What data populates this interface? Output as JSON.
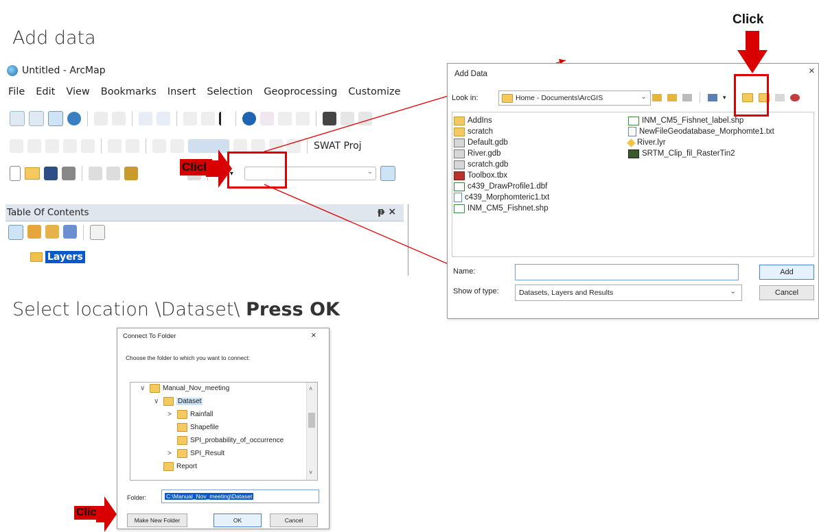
{
  "slide": {
    "title_add": "Add data",
    "title_select_prefix": "Select location \\Dataset\\ ",
    "title_select_bold": "Press OK",
    "click_label": "Click"
  },
  "arcmap": {
    "window_title": "Untitled - ArcMap",
    "menu": [
      "File",
      "Edit",
      "View",
      "Bookmarks",
      "Insert",
      "Selection",
      "Geoprocessing",
      "Customize"
    ],
    "swat_label": "SWAT Proj",
    "toc_title": "Table Of Contents",
    "toc_pin": "ј ×",
    "layers_label": "Layers"
  },
  "add_data": {
    "title": "Add Data",
    "close": "×",
    "look_in_label": "Look in:",
    "look_in_value": "Home - Documents\\ArcGIS",
    "files_left": [
      {
        "name": "AddIns",
        "icon": "folder"
      },
      {
        "name": "scratch",
        "icon": "folder"
      },
      {
        "name": "Default.gdb",
        "icon": "gdb"
      },
      {
        "name": "River.gdb",
        "icon": "gdb"
      },
      {
        "name": "scratch.gdb",
        "icon": "gdb"
      },
      {
        "name": "Toolbox.tbx",
        "icon": "toolbox"
      },
      {
        "name": "c439_DrawProfile1.dbf",
        "icon": "table"
      },
      {
        "name": "c439_Morphomteric1.txt",
        "icon": "doc"
      },
      {
        "name": "INM_CM5_Fishnet.shp",
        "icon": "shp"
      }
    ],
    "files_right": [
      {
        "name": "INM_CM5_Fishnet_label.shp",
        "icon": "shp"
      },
      {
        "name": "NewFileGeodatabase_Morphomte1.txt",
        "icon": "doc"
      },
      {
        "name": "River.lyr",
        "icon": "lyr"
      },
      {
        "name": "SRTM_Clip_fil_RasterTin2",
        "icon": "raster"
      }
    ],
    "name_label": "Name:",
    "name_value": "",
    "show_type_label": "Show of type:",
    "show_type_value": "Datasets, Layers and Results",
    "add_button": "Add",
    "cancel_button": "Cancel"
  },
  "connect_folder": {
    "title": "Connect To Folder",
    "close": "×",
    "prompt": "Choose the folder to which you want to connect:",
    "tree": [
      {
        "label": "Manual_Nov_meeting",
        "level": 0,
        "arrow": "∨"
      },
      {
        "label": "Dataset",
        "level": 1,
        "arrow": "∨",
        "selected": true
      },
      {
        "label": "Rainfall",
        "level": 2,
        "arrow": ">"
      },
      {
        "label": "Shapefile",
        "level": 2,
        "arrow": ""
      },
      {
        "label": "SPI_probability_of_occurrence",
        "level": 2,
        "arrow": ""
      },
      {
        "label": "SPI_Result",
        "level": 2,
        "arrow": ">"
      },
      {
        "label": "Report",
        "level": 1,
        "arrow": ""
      }
    ],
    "folder_label": "Folder:",
    "folder_value": "C:\\Manual_Nov_meeting\\Dataset",
    "new_folder_button": "Make New Folder",
    "ok_button": "OK",
    "cancel_button": "Cancel"
  },
  "colors": {
    "highlight": "#e00000",
    "selection": "#0078d7",
    "toc_header": "#dfe6ee"
  }
}
